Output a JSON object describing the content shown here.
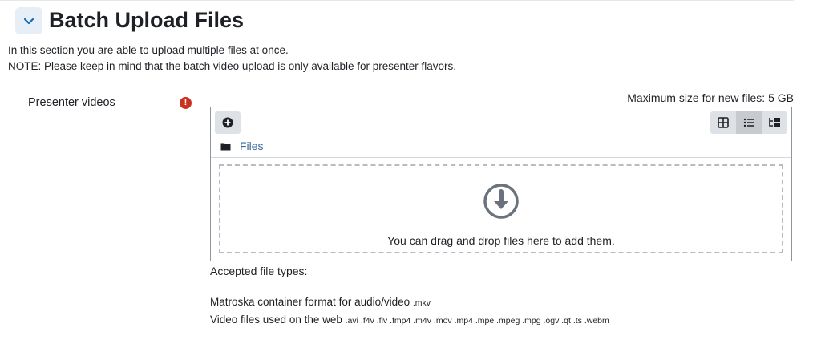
{
  "section": {
    "title": "Batch Upload Files",
    "toggle_icon": "chevron-down-icon",
    "intro_line1": "In this section you are able to upload multiple files at once.",
    "intro_line2": "NOTE: Please keep in mind that the batch video upload is only available for presenter flavors."
  },
  "field": {
    "label": "Presenter videos",
    "required_icon": "required-icon",
    "max_size": "Maximum size for new files: 5 GB"
  },
  "filepicker": {
    "add_icon": "add-file-icon",
    "view_buttons": [
      {
        "icon": "grid-view-icon",
        "active": false
      },
      {
        "icon": "list-view-icon",
        "active": true
      },
      {
        "icon": "tree-view-icon",
        "active": false
      }
    ],
    "folder_label": "Files",
    "drop_message": "You can drag and drop files here to add them."
  },
  "accepted": {
    "title": "Accepted file types:",
    "types": [
      {
        "name": "Matroska container format for audio/video",
        "extensions": ".mkv"
      },
      {
        "name": "Video files used on the web",
        "extensions": ".avi .f4v .flv .fmp4 .m4v .mov .mp4 .mpe .mpeg .mpg .ogv .qt .ts .webm"
      }
    ]
  },
  "colors": {
    "link": "#3a6b9b",
    "required": "#ca3120",
    "toggle_bg": "#e7eef5"
  }
}
